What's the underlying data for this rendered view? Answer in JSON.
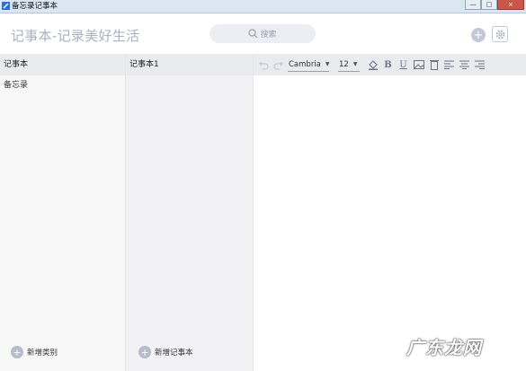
{
  "window": {
    "title": "备忘录记事本",
    "controls": {
      "minimize": "—",
      "maximize": "□",
      "close": "×"
    }
  },
  "header": {
    "app_title": "记事本-记录美好生活",
    "search_placeholder": "搜索",
    "add_icon": "plus-icon",
    "settings_icon": "gear-icon"
  },
  "categories": {
    "header": "记事本",
    "items": [
      "备忘录"
    ],
    "add_label": "新增类别"
  },
  "notebooks": {
    "header": "记事本1",
    "items": [],
    "add_label": "新增记事本"
  },
  "editor": {
    "toolbar": {
      "font_family": "Cambria",
      "font_size": "12",
      "buttons": [
        "undo-icon",
        "redo-icon",
        "fill-color-icon",
        "bold-icon",
        "underline-icon",
        "image-icon",
        "clear-icon",
        "align-left-icon",
        "align-center-icon",
        "align-right-icon"
      ],
      "bold_label": "B",
      "underline_label": "U"
    },
    "content": ""
  },
  "watermark": "广东龙网"
}
